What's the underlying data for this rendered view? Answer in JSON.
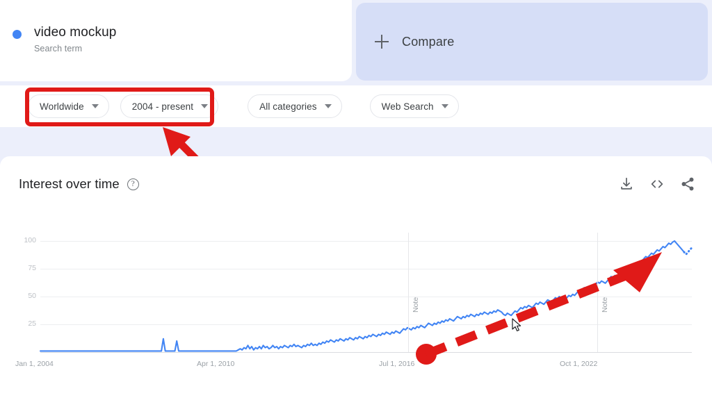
{
  "terms": {
    "primary": {
      "label": "video mockup",
      "sublabel": "Search term",
      "dot_color": "#4285f4"
    },
    "compare": {
      "label": "Compare",
      "icon": "plus-icon"
    }
  },
  "filters": [
    {
      "name": "location",
      "value": "Worldwide"
    },
    {
      "name": "time-range",
      "value": "2004 - present"
    },
    {
      "name": "category",
      "value": "All categories"
    },
    {
      "name": "search-type",
      "value": "Web Search"
    }
  ],
  "panel": {
    "title": "Interest over time",
    "help_icon": "help-icon",
    "actions": [
      {
        "name": "download-csv-button",
        "icon": "download-icon"
      },
      {
        "name": "embed-button",
        "icon": "code-icon"
      },
      {
        "name": "share-button",
        "icon": "share-icon"
      }
    ]
  },
  "annotations": {
    "highlight_rect_color": "#e01a18",
    "arrow_color": "#e01a18",
    "solid_arrow_label": "",
    "dashed_arrow_label": ""
  },
  "chart_data": {
    "type": "line",
    "title": "Interest over time",
    "xlabel": "",
    "ylabel": "",
    "ylim": [
      0,
      100
    ],
    "yticks": [
      25,
      50,
      75,
      100
    ],
    "ytick_labels": [
      "25",
      "50",
      "75",
      "100"
    ],
    "xtick_labels": [
      "Jan 1, 2004",
      "Apr 1, 2010",
      "Jul 1, 2016",
      "Oct 1, 2022"
    ],
    "grid": true,
    "legend": false,
    "line_color": "#4285f4",
    "note_markers": [
      {
        "label": "Note",
        "x_fraction": 0.565
      },
      {
        "label": "Note",
        "x_fraction": 0.855
      }
    ],
    "partial_data_dotted_tail": true,
    "series": [
      {
        "name": "video mockup",
        "values": [
          1,
          1,
          1,
          1,
          1,
          1,
          1,
          1,
          1,
          1,
          1,
          1,
          1,
          1,
          1,
          1,
          1,
          1,
          1,
          1,
          1,
          1,
          1,
          1,
          1,
          1,
          1,
          1,
          1,
          1,
          1,
          1,
          1,
          1,
          1,
          1,
          1,
          1,
          1,
          1,
          1,
          1,
          1,
          1,
          1,
          1,
          1,
          1,
          1,
          1,
          1,
          1,
          1,
          1,
          1,
          1,
          1,
          1,
          1,
          1,
          1,
          1,
          1,
          1,
          12,
          1,
          1,
          1,
          1,
          1,
          1,
          10,
          1,
          1,
          1,
          1,
          1,
          1,
          1,
          1,
          1,
          1,
          1,
          1,
          1,
          1,
          1,
          1,
          1,
          1,
          1,
          1,
          1,
          1,
          1,
          1,
          1,
          1,
          1,
          1,
          1,
          1,
          1,
          2,
          3,
          2,
          4,
          3,
          6,
          3,
          5,
          2,
          4,
          3,
          5,
          3,
          6,
          4,
          5,
          3,
          4,
          6,
          4,
          5,
          3,
          5,
          4,
          6,
          5,
          4,
          6,
          5,
          7,
          5,
          6,
          5,
          4,
          6,
          5,
          7,
          6,
          8,
          6,
          7,
          6,
          8,
          7,
          9,
          8,
          10,
          9,
          11,
          10,
          9,
          11,
          10,
          12,
          11,
          10,
          12,
          11,
          13,
          12,
          11,
          13,
          12,
          14,
          13,
          12,
          14,
          13,
          15,
          14,
          16,
          15,
          14,
          16,
          15,
          17,
          16,
          18,
          17,
          16,
          18,
          17,
          19,
          18,
          17,
          19,
          21,
          20,
          22,
          21,
          20,
          22,
          21,
          23,
          22,
          24,
          23,
          22,
          24,
          26,
          25,
          24,
          26,
          25,
          27,
          26,
          28,
          27,
          29,
          28,
          30,
          29,
          28,
          30,
          32,
          31,
          30,
          32,
          31,
          33,
          32,
          34,
          33,
          32,
          34,
          33,
          35,
          34,
          36,
          35,
          34,
          36,
          35,
          37,
          36,
          38,
          37,
          36,
          34,
          33,
          35,
          34,
          33,
          35,
          37,
          36,
          38,
          40,
          39,
          41,
          40,
          42,
          41,
          40,
          42,
          44,
          43,
          45,
          44,
          43,
          45,
          47,
          46,
          45,
          47,
          49,
          48,
          50,
          49,
          48,
          47,
          49,
          51,
          50,
          52,
          51,
          53,
          55,
          54,
          56,
          58,
          57,
          56,
          58,
          60,
          59,
          61,
          63,
          62,
          64,
          63,
          62,
          64,
          66,
          68,
          67,
          69,
          68,
          70,
          72,
          71,
          73,
          75,
          74,
          76,
          78,
          77,
          79,
          81,
          80,
          82,
          84,
          86,
          85,
          87,
          89,
          88,
          90,
          92,
          91,
          93,
          95,
          94,
          96,
          98,
          97,
          99,
          100,
          98,
          96,
          94,
          92,
          90,
          88,
          90,
          92,
          94
        ]
      }
    ]
  }
}
